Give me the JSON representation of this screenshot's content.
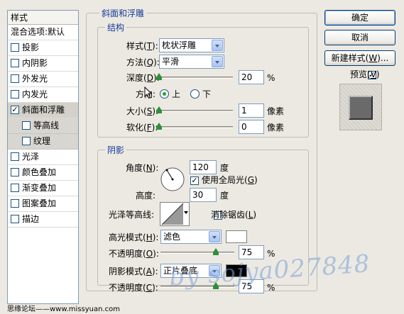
{
  "sidebar": {
    "header": "样式",
    "blend": "混合选项:默认",
    "items": [
      {
        "label": "投影",
        "checked": false,
        "sub": false
      },
      {
        "label": "内阴影",
        "checked": false,
        "sub": false
      },
      {
        "label": "外发光",
        "checked": false,
        "sub": false
      },
      {
        "label": "内发光",
        "checked": false,
        "sub": false
      },
      {
        "label": "斜面和浮雕",
        "checked": true,
        "sub": false
      },
      {
        "label": "等高线",
        "checked": false,
        "sub": true
      },
      {
        "label": "纹理",
        "checked": false,
        "sub": true
      },
      {
        "label": "光泽",
        "checked": false,
        "sub": false
      },
      {
        "label": "颜色叠加",
        "checked": false,
        "sub": false
      },
      {
        "label": "渐变叠加",
        "checked": false,
        "sub": false
      },
      {
        "label": "图案叠加",
        "checked": false,
        "sub": false
      },
      {
        "label": "描边",
        "checked": false,
        "sub": false
      }
    ]
  },
  "bevel": {
    "title": "斜面和浮雕",
    "structure_title": "结构",
    "style_label": "样式(",
    "style_key": "T",
    "style_value": "枕状浮雕",
    "technique_label": "方法(",
    "technique_key": "Q",
    "technique_value": "平滑",
    "depth_label": "深度(",
    "depth_key": "D",
    "depth_value": "20",
    "depth_unit": "%",
    "depth_level": 0.0,
    "direction_label": "方向:",
    "direction_up": "上",
    "direction_down": "下",
    "size_label": "大小(",
    "size_key": "S",
    "size_value": "1",
    "size_unit": "像素",
    "size_level": 0.0,
    "soften_label": "软化(",
    "soften_key": "F",
    "soften_value": "0",
    "soften_unit": "像素",
    "soften_level": 0.0,
    "close_paren": "):"
  },
  "shading": {
    "title": "阴影",
    "angle_label": "角度(",
    "angle_key": "N",
    "angle_value": "120",
    "angle_unit": "度",
    "global_light_label": "使用全局光(",
    "global_light_key": "G",
    "altitude_label": "高度:",
    "altitude_value": "30",
    "altitude_unit": "度",
    "gloss_label": "光泽等高线:",
    "antialias_label": "消除锯齿(",
    "antialias_key": "L",
    "highlight_label": "高光模式(",
    "highlight_key": "H",
    "highlight_value": "滤色",
    "highlight_color": "#ffffff",
    "opacity1_label": "不透明度(",
    "opacity1_key": "O",
    "opacity1_value": "75",
    "opacity_unit": "%",
    "opacity1_level": 0.75,
    "shadow_label": "阴影模式(",
    "shadow_key": "A",
    "shadow_value": "正片叠底",
    "shadow_color": "#000000",
    "opacity2_label": "不透明度(",
    "opacity2_key": "C",
    "opacity2_value": "75",
    "opacity2_level": 0.75,
    "close_paren": "):",
    "close_paren_only": ")"
  },
  "buttons": {
    "ok": "确定",
    "cancel": "取消",
    "new_style": "新建样式(",
    "new_style_key": "W",
    "new_style_tail": ")...",
    "preview_label": "预览(",
    "preview_key": "V",
    "preview_tail": ")"
  },
  "watermark": "by sojya027848",
  "footer": "思缘论坛——www.missyuan.com",
  "colors": {
    "accent": "#153b99",
    "slider_thumb": "#2f8f3a"
  }
}
